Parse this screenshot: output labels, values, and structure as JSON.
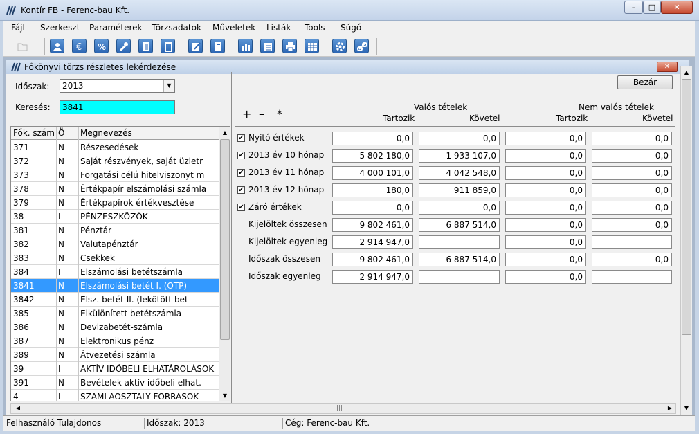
{
  "window": {
    "title": "Kontír FB  -  Ferenc-bau Kft."
  },
  "menu": [
    "Fájl",
    "Szerkeszt",
    "Paraméterek",
    "Törzsadatok",
    "Műveletek",
    "Listák",
    "Tools",
    "Súgó"
  ],
  "toolbar_icons": [
    "folder-icon",
    "user-icon",
    "euro-icon",
    "percent-icon",
    "wrench-icon",
    "document-icon",
    "clipboard-icon",
    "edit-icon",
    "calculator-icon",
    "bar-chart-icon",
    "report-icon",
    "printer-icon",
    "table-icon",
    "gear-icon",
    "link-icon"
  ],
  "child": {
    "title": "Főkönyvi törzs részletes lekérdezése"
  },
  "filters": {
    "period_label": "Időszak:",
    "period_value": "2013",
    "search_label": "Keresés:",
    "search_value": "3841"
  },
  "close_button": "Bezár",
  "accounts": {
    "columns": [
      "Fők. szám",
      "Ö",
      "Megnevezés"
    ],
    "rows": [
      [
        "371",
        "N",
        "Részesedések"
      ],
      [
        "372",
        "N",
        "Saját részvények, saját üzletr"
      ],
      [
        "373",
        "N",
        "Forgatási célú hitelviszonyt m"
      ],
      [
        "378",
        "N",
        "Értékpapír elszámolási számla"
      ],
      [
        "379",
        "N",
        "Értékpapírok értékvesztése"
      ],
      [
        "38",
        "I",
        "PÉNZESZKÖZÖK"
      ],
      [
        "381",
        "N",
        "Pénztár"
      ],
      [
        "382",
        "N",
        "Valutapénztár"
      ],
      [
        "383",
        "N",
        "Csekkek"
      ],
      [
        "384",
        "I",
        "Elszámolási betétszámla"
      ],
      [
        "3841",
        "N",
        "Elszámolási betét I. (OTP)"
      ],
      [
        "3842",
        "N",
        "Elsz. betét II. (lekötött bet"
      ],
      [
        "385",
        "N",
        "Elkülönített betétszámla"
      ],
      [
        "386",
        "N",
        "Devizabetét-számla"
      ],
      [
        "387",
        "N",
        "Elektronikus pénz"
      ],
      [
        "389",
        "N",
        "Átvezetési számla"
      ],
      [
        "39",
        "I",
        "AKTÍV IDŐBELI ELHATÁROLÁSOK"
      ],
      [
        "391",
        "N",
        "Bevételek aktív időbeli elhat."
      ],
      [
        "4",
        "I",
        "SZÁMLAOSZTÁLY FORRÁSOK"
      ]
    ],
    "selected": "3841"
  },
  "summary": {
    "symbols": [
      "+",
      "–",
      "*"
    ],
    "group_real": "Valós tételek",
    "group_unreal": "Nem valós tételek",
    "col_debit": "Tartozik",
    "col_credit": "Követel",
    "rows": [
      {
        "label": "Nyitó értékek",
        "checkbox": true,
        "values": [
          "0,0",
          "0,0",
          "0,0",
          "0,0"
        ]
      },
      {
        "label": "2013 év 10 hónap",
        "checkbox": true,
        "values": [
          "5 802 180,0",
          "1 933 107,0",
          "0,0",
          "0,0"
        ]
      },
      {
        "label": "2013 év 11 hónap",
        "checkbox": true,
        "values": [
          "4 000 101,0",
          "4 042 548,0",
          "0,0",
          "0,0"
        ]
      },
      {
        "label": "2013 év 12 hónap",
        "checkbox": true,
        "values": [
          "180,0",
          "911 859,0",
          "0,0",
          "0,0"
        ]
      },
      {
        "label": "Záró értékek",
        "checkbox": true,
        "values": [
          "0,0",
          "0,0",
          "0,0",
          "0,0"
        ]
      },
      {
        "label": "Kijelöltek összesen",
        "checkbox": false,
        "values": [
          "9 802 461,0",
          "6 887 514,0",
          "0,0",
          "0,0"
        ]
      },
      {
        "label": "Kijelöltek egyenleg",
        "checkbox": false,
        "values": [
          "2 914 947,0",
          "",
          "0,0",
          ""
        ]
      },
      {
        "label": "Időszak összesen",
        "checkbox": false,
        "values": [
          "9 802 461,0",
          "6 887 514,0",
          "0,0",
          "0,0"
        ]
      },
      {
        "label": "Időszak egyenleg",
        "checkbox": false,
        "values": [
          "2 914 947,0",
          "",
          "0,0",
          ""
        ]
      }
    ]
  },
  "status": {
    "user": "Felhasználó Tulajdonos",
    "period": "Időszak: 2013",
    "company": "Cég: Ferenc-bau Kft."
  },
  "colors": {
    "selection": "#3399ff",
    "search_bg": "#00ffff",
    "toolbar_icon": "#2d67b4"
  }
}
